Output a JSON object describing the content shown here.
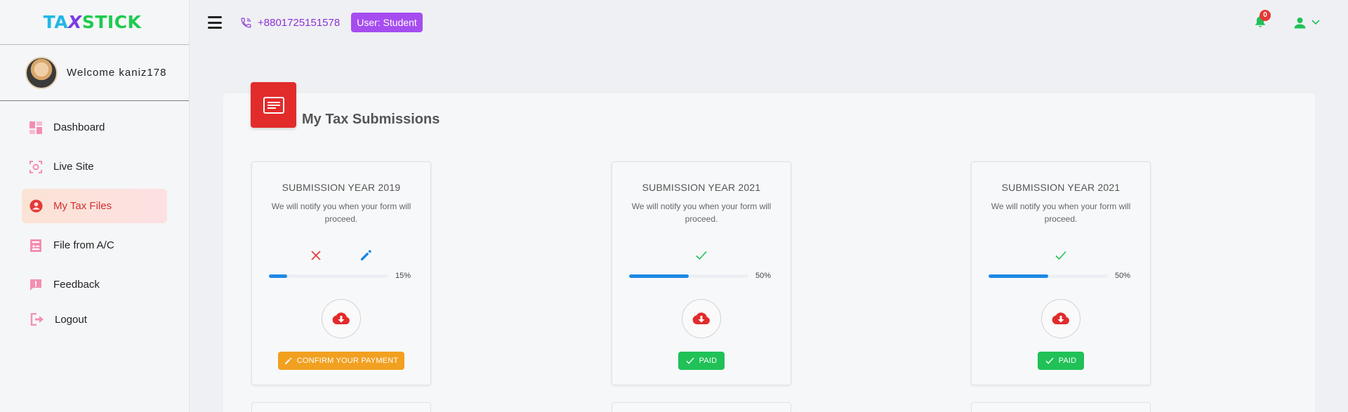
{
  "app": {
    "logo": {
      "part1": "TA",
      "part2": "X",
      "part3": "STICK"
    },
    "welcome_text": "Welcome kaniz178"
  },
  "sidebar": {
    "items": [
      {
        "label": "Dashboard",
        "icon": "dashboard-icon"
      },
      {
        "label": "Live Site",
        "icon": "live-site-icon"
      },
      {
        "label": "My Tax Files",
        "icon": "account-circle-icon",
        "active": true
      },
      {
        "label": "File from A/C",
        "icon": "file-account-icon"
      },
      {
        "label": "Feedback",
        "icon": "feedback-icon"
      },
      {
        "label": "Logout",
        "icon": "logout-icon"
      }
    ]
  },
  "topbar": {
    "phone": "+8801725151578",
    "user_badge": "User:  Student",
    "notification_count": "0"
  },
  "main": {
    "title": "My Tax Submissions",
    "cards": [
      {
        "title": "SUBMISSION YEAR 2019",
        "description": "We will notify you when your form will proceed.",
        "progress": 15,
        "progress_label": "15%",
        "status": "rejected",
        "button_label": "CONFIRM YOUR PAYMENT"
      },
      {
        "title": "SUBMISSION YEAR 2021",
        "description": "We will notify you when your form will proceed.",
        "progress": 50,
        "progress_label": "50%",
        "status": "approved",
        "button_label": "PAID"
      },
      {
        "title": "SUBMISSION YEAR 2021",
        "description": "We will notify you when your form will proceed.",
        "progress": 50,
        "progress_label": "50%",
        "status": "approved",
        "button_label": "PAID"
      }
    ]
  },
  "colors": {
    "accent_purple": "#a64df0",
    "active_red": "#d32f2f",
    "header_icon_red": "#e22b2b",
    "progress_blue": "#1e88e5",
    "paid_green": "#20c157",
    "confirm_orange": "#f2a020"
  }
}
